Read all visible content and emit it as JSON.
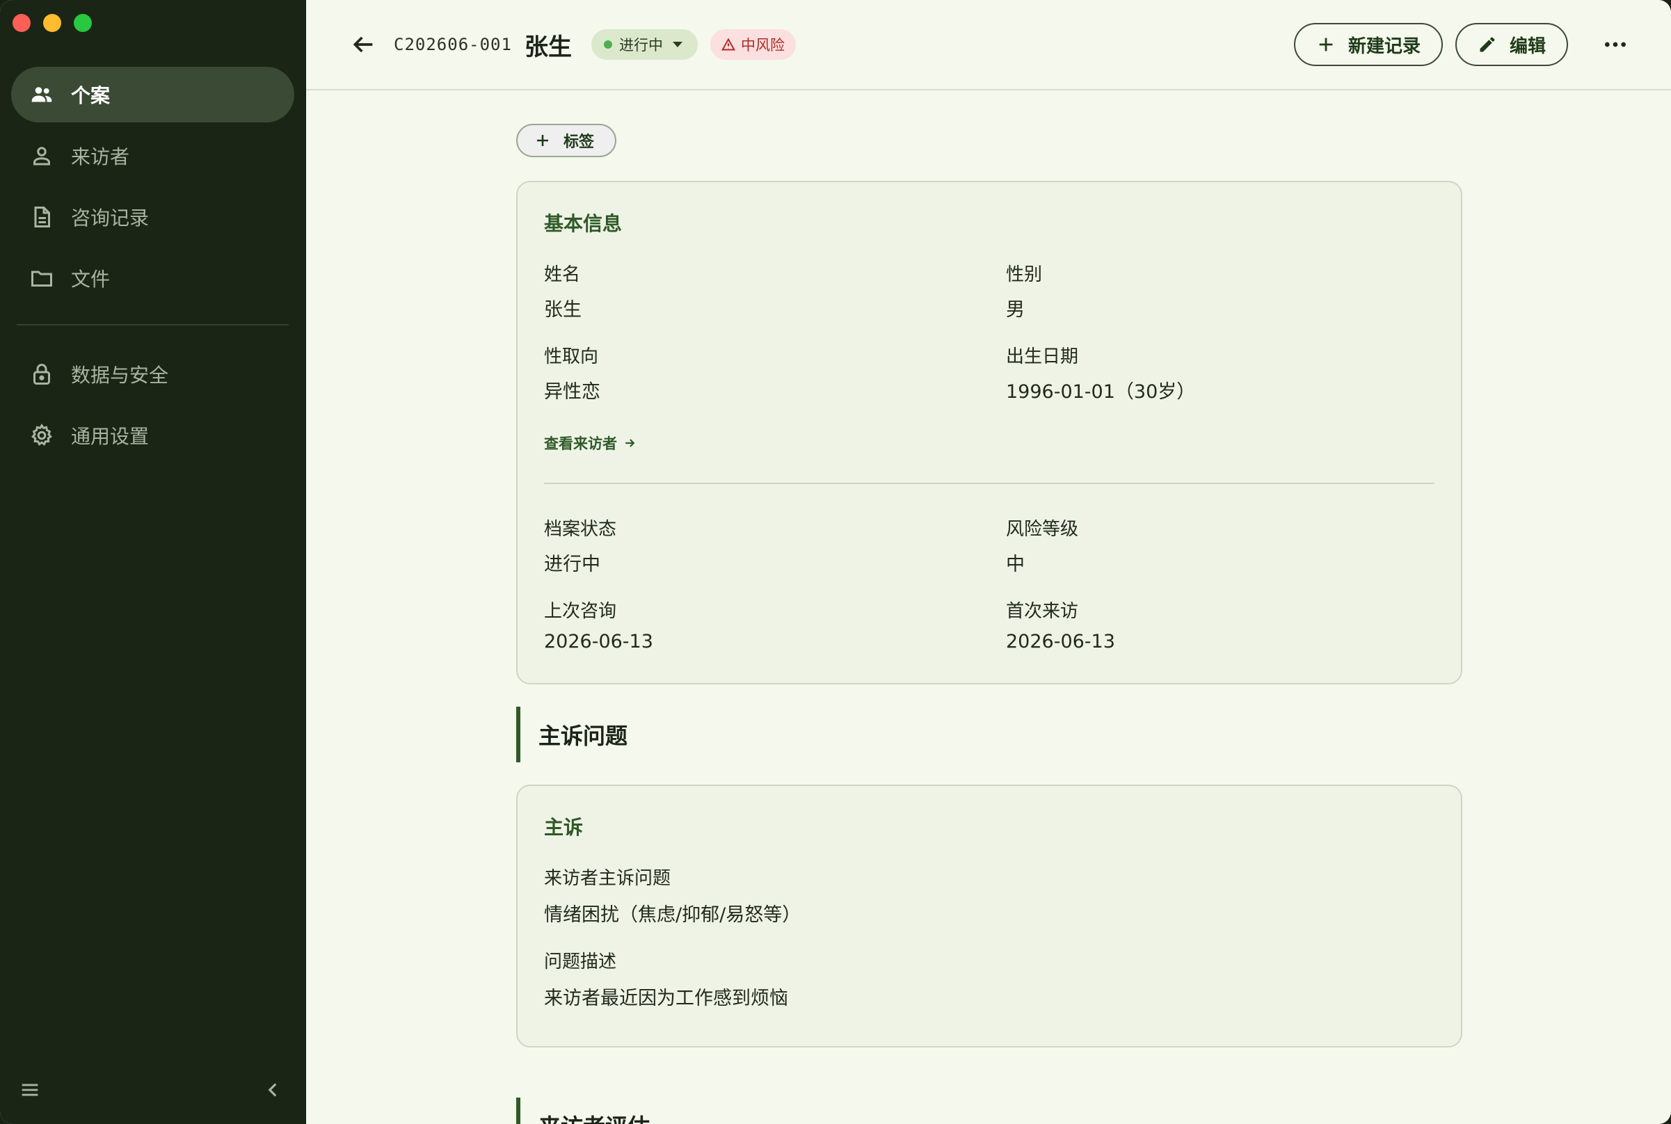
{
  "sidebar": {
    "items": [
      {
        "label": "个案",
        "icon": "people-icon",
        "active": true
      },
      {
        "label": "来访者",
        "icon": "person-icon",
        "active": false
      },
      {
        "label": "咨询记录",
        "icon": "document-icon",
        "active": false
      },
      {
        "label": "文件",
        "icon": "folder-icon",
        "active": false
      }
    ],
    "items2": [
      {
        "label": "数据与安全",
        "icon": "lock-icon"
      },
      {
        "label": "通用设置",
        "icon": "gear-icon"
      }
    ]
  },
  "header": {
    "case_id": "C202606-001",
    "name": "张生",
    "status": "进行中",
    "risk": "中风险",
    "new_record": "新建记录",
    "edit": "编辑"
  },
  "tag_button": "标签",
  "basic_info": {
    "title": "基本信息",
    "fields": [
      {
        "label": "姓名",
        "value": "张生"
      },
      {
        "label": "性别",
        "value": "男"
      },
      {
        "label": "性取向",
        "value": "异性恋"
      },
      {
        "label": "出生日期",
        "value": "1996-01-01（30岁）"
      }
    ],
    "view_visitor": "查看来访者",
    "fields2": [
      {
        "label": "档案状态",
        "value": "进行中"
      },
      {
        "label": "风险等级",
        "value": "中"
      },
      {
        "label": "上次咨询",
        "value": "2026-06-13"
      },
      {
        "label": "首次来访",
        "value": "2026-06-13"
      }
    ]
  },
  "section_complaint": "主诉问题",
  "complaint": {
    "title": "主诉",
    "fields": [
      {
        "label": "来访者主诉问题",
        "value": "情绪困扰（焦虑/抑郁/易怒等）"
      },
      {
        "label": "问题描述",
        "value": "来访者最近因为工作感到烦恼"
      }
    ]
  },
  "section_assessment": "来访者评估",
  "colors": {
    "sidebar_bg": "#1a2516",
    "accent": "#2f5a28",
    "risk": "#b02a24",
    "status_dot": "#4caf50"
  }
}
